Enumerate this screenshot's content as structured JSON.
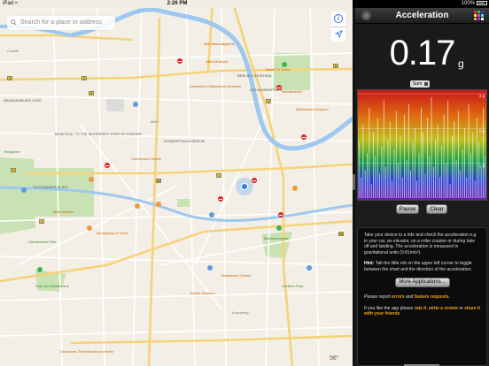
{
  "status_bar": {
    "carrier": "iPad ≈",
    "time": "2:26 PM",
    "battery": "100%"
  },
  "map": {
    "search_placeholder": "Search for a place or address",
    "info_icon": "i",
    "weather": "56°",
    "labels": [
      {
        "t": "Charité",
        "c": "rd"
      },
      {
        "t": "ALEXANDERPLATZ",
        "c": ""
      },
      {
        "t": "Alte Nationalgalerie",
        "c": "o"
      },
      {
        "t": "Altes Museum",
        "c": "o"
      },
      {
        "t": "BERLIN CATHEDRAL",
        "c": ""
      },
      {
        "t": "Berlin TV Tower",
        "c": "o"
      },
      {
        "t": "Deutsches Historisches Museum",
        "c": "o"
      },
      {
        "t": "Nikolaiviertel",
        "c": "o"
      },
      {
        "t": "Märkisches Museum",
        "c": "o"
      },
      {
        "t": "Berlinische Galerie",
        "c": "o"
      },
      {
        "t": "BRANDENBURG GATE",
        "c": ""
      },
      {
        "t": "MEMORIAL TO THE MURDERED JEWS OF EUROPE",
        "c": ""
      },
      {
        "t": "POTSDAMER PLATZ",
        "c": ""
      },
      {
        "t": "Tiergarten",
        "c": "g"
      },
      {
        "t": "KONZERTHAUS BERLIN",
        "c": ""
      },
      {
        "t": "Checkpoint Charlie",
        "c": "o"
      },
      {
        "t": "Topography of Terror",
        "c": "o"
      },
      {
        "t": "Jewish Museum",
        "c": "o"
      },
      {
        "t": "Mall of Berlin",
        "c": "o"
      },
      {
        "t": "Gleisdreieck Park",
        "c": "g"
      },
      {
        "t": "Deutsches Technikmuseum Berlin",
        "c": "o"
      },
      {
        "t": "Park am Gleisdreieck",
        "c": "g"
      },
      {
        "t": "Mariannenplatz",
        "c": "g"
      },
      {
        "t": "Görlitzer Park",
        "c": "g"
      },
      {
        "t": "Kreuzberg",
        "c": "rd"
      },
      {
        "t": "Mitte",
        "c": "rd"
      }
    ]
  },
  "app": {
    "title": "Acceleration",
    "value": "0.17",
    "unit": "g",
    "mode": "Sum",
    "y_labels": [
      "3 g",
      "2 g",
      "1 g"
    ],
    "pause_label": "Pause",
    "clear_label": "Clear",
    "info_text": "Take your device to a ride and check the acceleration e.g. in your car, an elevator, on a roller coaster or during take off and landing. The acceleration is measured in gravitational units (9.81m/s²).",
    "hint_label": "Hint:",
    "hint_text": "Tab the little orb on the upper left corner to toggle between the chart and the direction of the acceleration.",
    "more_apps_label": "More Applications...",
    "report_prefix": "Please report",
    "report_errors": "errors",
    "report_and": "and",
    "report_features": "feature requests",
    "like_prefix": "If you like the app please",
    "rate_it": "rate it",
    "write_review": "write a review",
    "or": "or",
    "share_it": "share it with your friends",
    "grid_colors": [
      "#e33",
      "#3c3",
      "#33e",
      "#ee3",
      "#e3e",
      "#3ee",
      "#f93",
      "#93f",
      "#fff"
    ]
  },
  "chart_data": {
    "type": "bar",
    "title": "",
    "ylabel": "g",
    "ylim": [
      0,
      3
    ],
    "grid": true,
    "bar_colors": "rainbow gradient by height",
    "values": [
      1.6,
      0.6,
      2.1,
      0.8,
      1.3,
      2.6,
      0.4,
      1.9,
      1.2,
      2.3,
      0.7,
      1.5,
      2.8,
      0.9,
      1.7,
      2.2,
      0.5,
      1.4,
      2.5,
      1.0,
      1.8,
      0.6,
      2.4,
      1.1,
      2.7,
      0.8,
      1.6,
      2.0,
      0.5,
      1.3,
      2.6,
      1.9,
      0.7,
      2.3,
      1.2,
      2.9,
      0.9,
      1.7,
      2.1,
      0.6,
      1.5,
      2.4,
      1.0,
      2.8,
      0.4,
      1.8,
      2.2,
      1.1,
      2.5,
      0.8,
      1.4,
      2.0,
      0.6,
      2.7,
      1.3,
      1.9,
      0.5,
      2.3,
      1.6,
      0.9,
      2.6,
      1.2
    ]
  }
}
